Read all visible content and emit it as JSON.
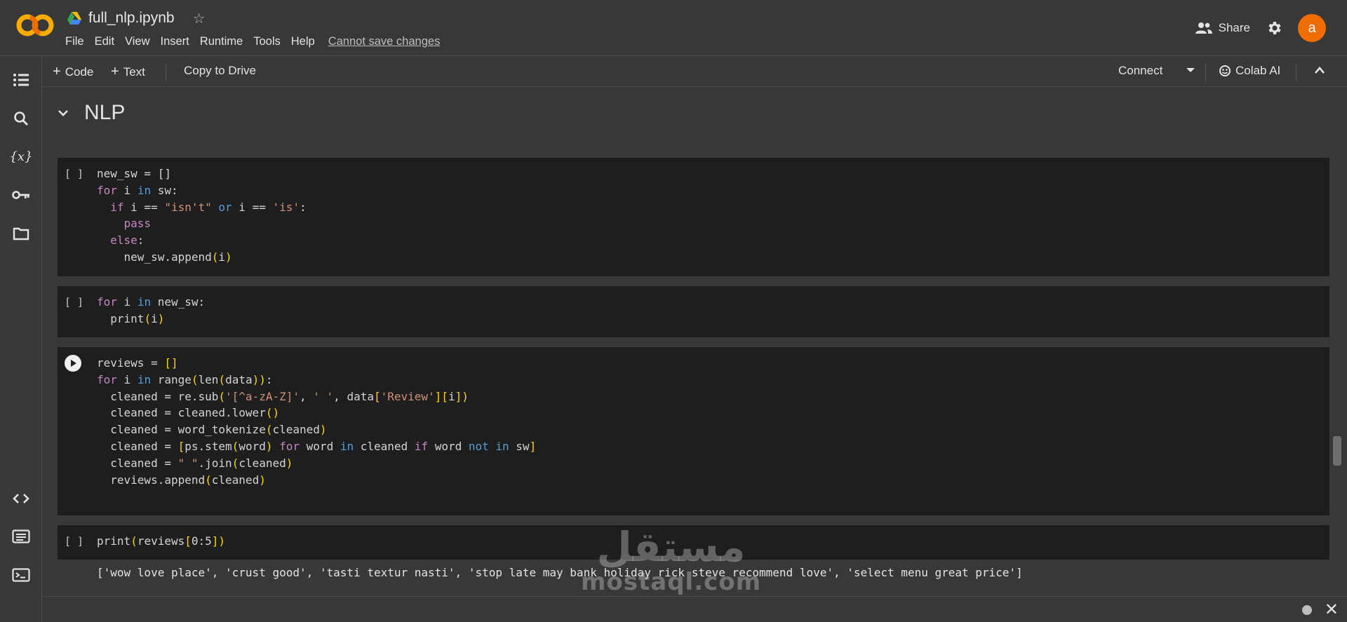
{
  "header": {
    "logo": "CO",
    "notebook_title": "full_nlp.ipynb",
    "menu": [
      "File",
      "Edit",
      "View",
      "Insert",
      "Runtime",
      "Tools",
      "Help"
    ],
    "save_warning": "Cannot save changes",
    "share_label": "Share",
    "avatar_letter": "a"
  },
  "toolbar": {
    "add_code": "Code",
    "add_text": "Text",
    "copy_to_drive": "Copy to Drive",
    "connect": "Connect",
    "colab_ai": "Colab AI"
  },
  "section": {
    "title": "NLP"
  },
  "cells": [
    {
      "gutter": "[ ]",
      "lines": [
        "new_sw = []",
        "for i in sw:",
        "  if i == \"isn't\" or i == 'is':",
        "    pass",
        "  else:",
        "    new_sw.append(i)"
      ]
    },
    {
      "gutter": "[ ]",
      "lines": [
        "for i in new_sw:",
        "  print(i)"
      ]
    },
    {
      "gutter": "run",
      "lines": [
        "reviews = []",
        "for i in range(len(data)):",
        "  cleaned = re.sub('[^a-zA-Z]', ' ', data['Review'][i])",
        "  cleaned = cleaned.lower()",
        "  cleaned = word_tokenize(cleaned)",
        "  cleaned = [ps.stem(word) for word in cleaned if word not in sw]",
        "  cleaned = \" \".join(cleaned)",
        "  reviews.append(cleaned)"
      ]
    },
    {
      "gutter": "[ ]",
      "lines": [
        "print(reviews[0:5])"
      ],
      "output": "['wow love place', 'crust good', 'tasti textur nasti', 'stop late may bank holiday rick steve recommend love', 'select menu great price']"
    }
  ],
  "watermark": {
    "arabic": "مستقل",
    "latin": "mostaql.com"
  },
  "colors": {
    "accent_orange": "#ef6c00",
    "logo_yellow": "#f9ab00",
    "keyword_blue": "#569cd6",
    "control_purple": "#c586c0",
    "string_orange": "#ce9178",
    "bracket_gold": "#ffd700"
  },
  "icons": [
    "table-of-contents-icon",
    "search-icon",
    "variables-icon",
    "key-icon",
    "folder-icon",
    "code-snippets-icon",
    "command-palette-icon",
    "terminal-icon",
    "settings-icon",
    "people-icon",
    "star-icon",
    "drive-icon",
    "play-icon"
  ]
}
